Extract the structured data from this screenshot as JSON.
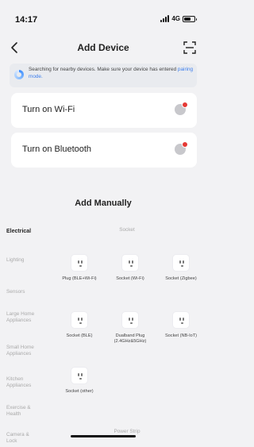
{
  "status": {
    "time": "14:17",
    "network": "4G"
  },
  "nav": {
    "title": "Add Device",
    "back_icon": "chevron-left-icon",
    "scan_icon": "scan-icon"
  },
  "search": {
    "text": "Searching for nearby devices. Make sure your device has entered",
    "link": "pairing mode."
  },
  "cards": {
    "wifi_label": "Turn on Wi-Fi",
    "bt_label": "Turn on Bluetooth"
  },
  "add_manually": {
    "title": "Add Manually",
    "categories": [
      "Electrical",
      "Lighting",
      "Sensors",
      "Large Home Appliances",
      "Small Home Appliances",
      "Kitchen Appliances",
      "Exercise & Health",
      "Camera & Lock"
    ],
    "sub_header_top": "Socket",
    "sub_header_bottom": "Power Strip",
    "tiles": [
      "Plug (BLE+Wi-Fi)",
      "Socket (Wi-Fi)",
      "Socket (Zigbee)",
      "Socket (BLE)",
      "Dualband Plug (2.4GHz&5GHz)",
      "Socket (NB-IoT)",
      "Socket (other)"
    ]
  },
  "colors": {
    "accent": "#3b7ded",
    "alert": "#e53935",
    "background": "#f2f2f4"
  }
}
